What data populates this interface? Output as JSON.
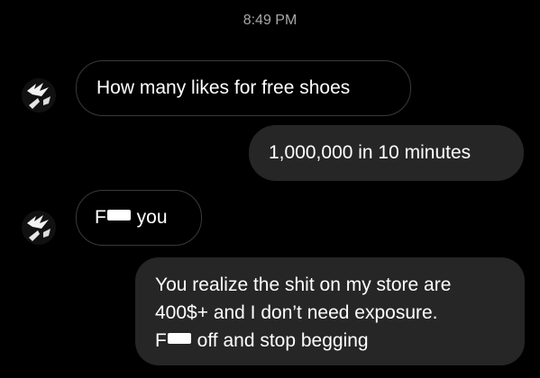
{
  "chat": {
    "timestamp": "8:49 PM",
    "messages": [
      {
        "sender": "them",
        "text": "How many likes for free shoes"
      },
      {
        "sender": "me",
        "text": "1,000,000 in 10 minutes"
      },
      {
        "sender": "them",
        "prefix": "F",
        "suffix": " you",
        "censored": true
      },
      {
        "sender": "me",
        "line1": "You realize the shit on my store are",
        "line2": "400$+ and I don’t need exposure.",
        "line3_prefix": "F",
        "line3_suffix": " off and stop begging",
        "censored": true
      }
    ]
  },
  "colors": {
    "background": "#000000",
    "outgoing_bubble": "#262626",
    "incoming_border": "#3a3a3a",
    "timestamp": "#a8a8a8",
    "text": "#ffffff"
  }
}
